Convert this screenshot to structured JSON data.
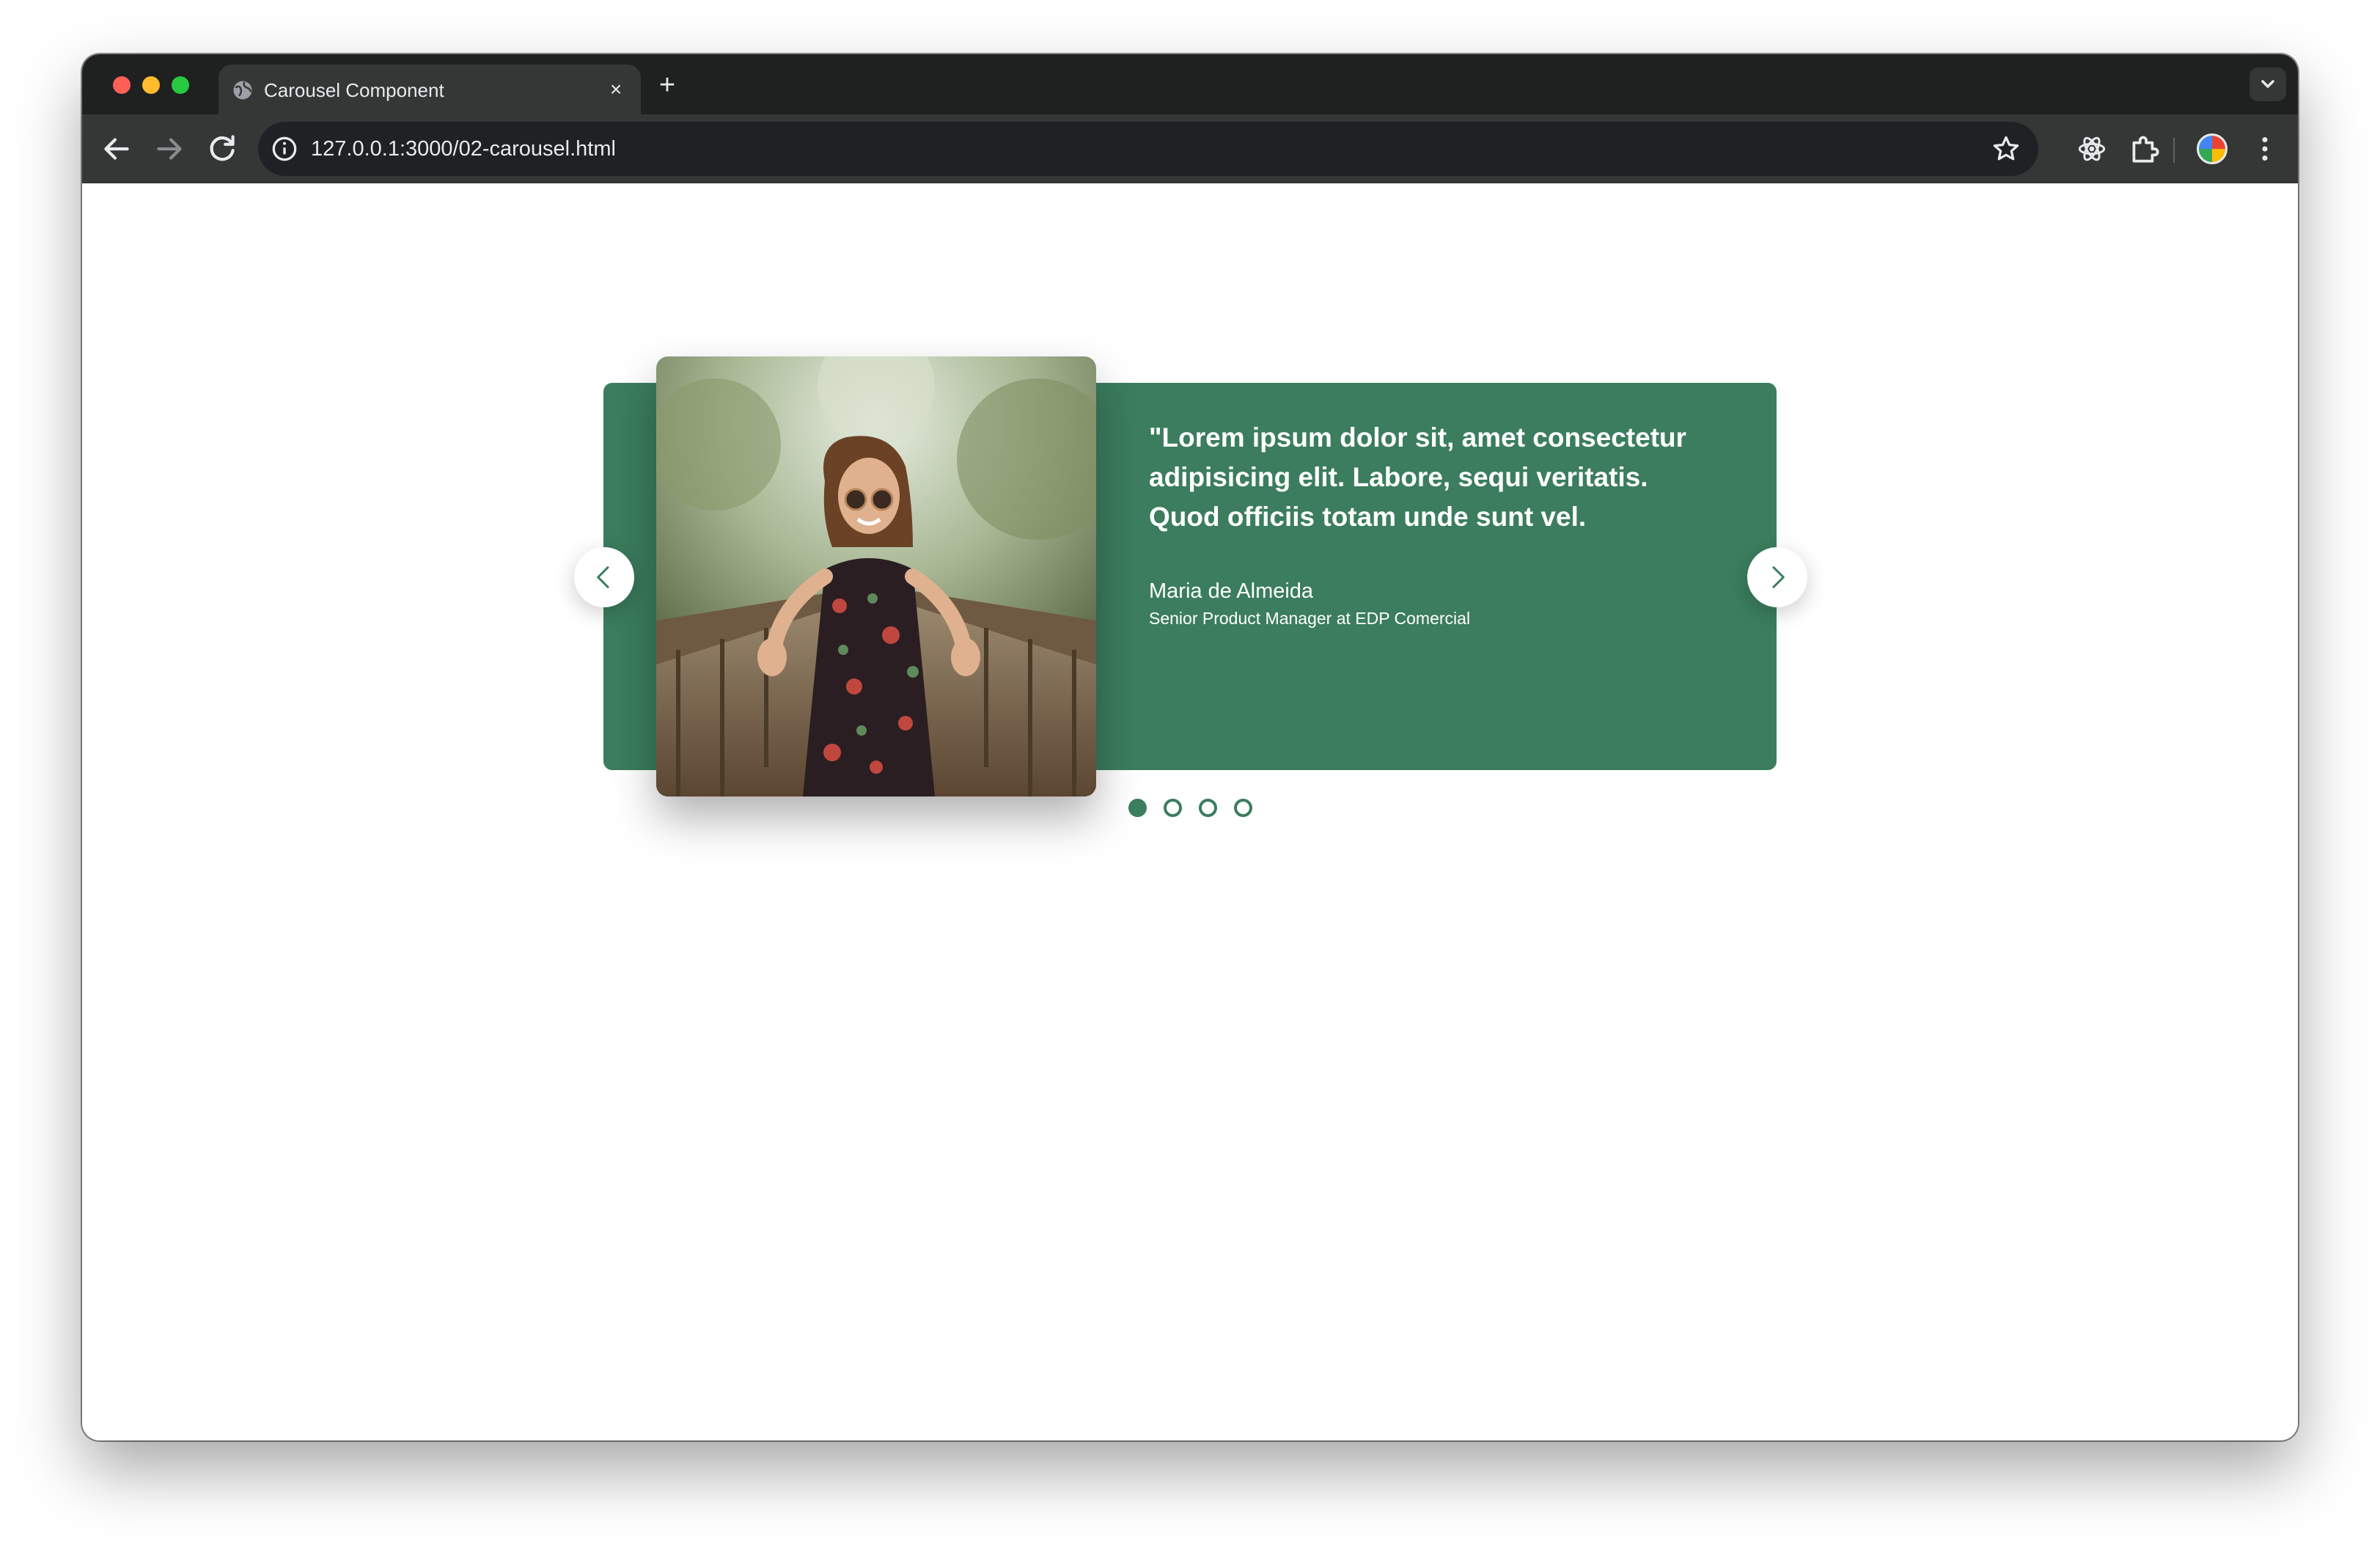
{
  "browser": {
    "tab_title": "Carousel Component",
    "tab_close": "×",
    "new_tab": "+",
    "url": "127.0.0.1:3000/02-carousel.html"
  },
  "carousel": {
    "accent_color": "#3b7d5e",
    "quote": "\"Lorem ipsum dolor sit, amet consectetur adipisicing elit. Labore, sequi veritatis. Quod officiis totam unde sunt vel.",
    "author_name": "Maria de Almeida",
    "author_role": "Senior Product Manager at EDP Comercial",
    "slide_count": 4,
    "active_slide": 1,
    "photo_description_icon": "photo-woman-on-bridge"
  }
}
